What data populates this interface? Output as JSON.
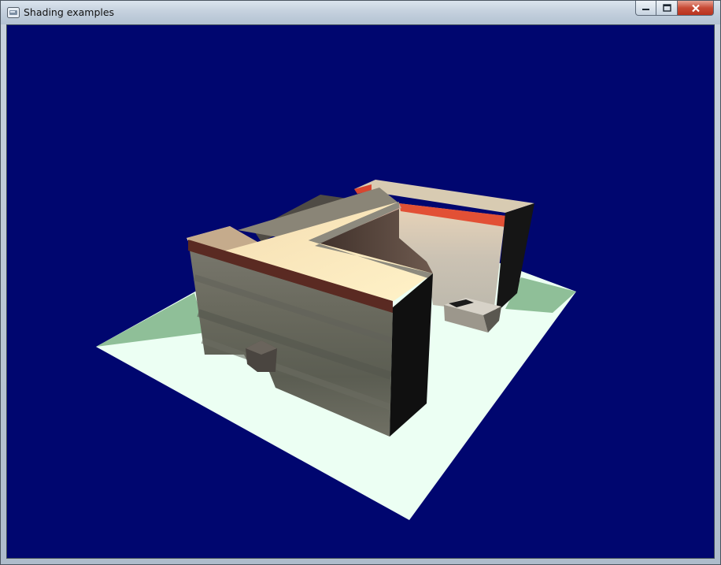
{
  "window": {
    "title": "Shading examples",
    "app_icon": "window-app-icon",
    "controls": {
      "minimize": "minimize-icon",
      "maximize": "maximize-icon",
      "close": "close-icon"
    }
  },
  "scene": {
    "background_color": "#00066f",
    "ground_color": "#ecfff3",
    "ground_shadow_color": "#8fbf98",
    "wall_color": "#76746c",
    "roof_color": "#fff0c4",
    "accent_stripe_color": "#e25035"
  }
}
